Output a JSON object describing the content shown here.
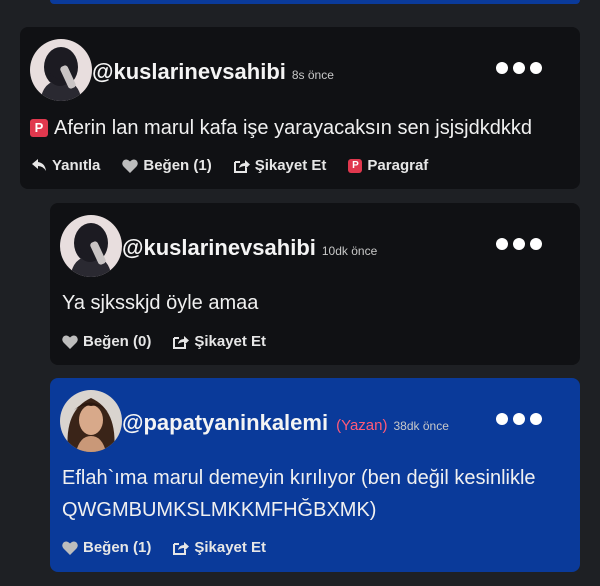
{
  "comments": [
    {
      "username": "@kuslarinevsahibi",
      "time": "8s önce",
      "text": "Aferin lan marul kafa işe yarayacaksın sen jsjsjdkdkkd",
      "badge_letter": "P",
      "reply_label": "Yanıtla",
      "like_label": "Beğen (1)",
      "report_label": "Şikayet Et",
      "paragraph_label": "Paragraf"
    },
    {
      "username": "@kuslarinevsahibi",
      "time": "10dk önce",
      "text": "Ya sjksskjd öyle amaa",
      "like_label": "Beğen (0)",
      "report_label": "Şikayet Et"
    },
    {
      "username": "@papatyaninkalemi",
      "author_badge": "(Yazan)",
      "time": "38dk önce",
      "text": "Eflah`ıma marul demeyin kırılıyor (ben değil kesinlikle QWGMBUMKSLMKKMFHĞBXMK)",
      "like_label": "Beğen (1)",
      "report_label": "Şikayet Et"
    }
  ],
  "colors": {
    "background": "#1e2024",
    "card": "#101114",
    "author_card": "#0a3a9a",
    "badge": "#e0384e",
    "author_label": "#ff5a78"
  }
}
